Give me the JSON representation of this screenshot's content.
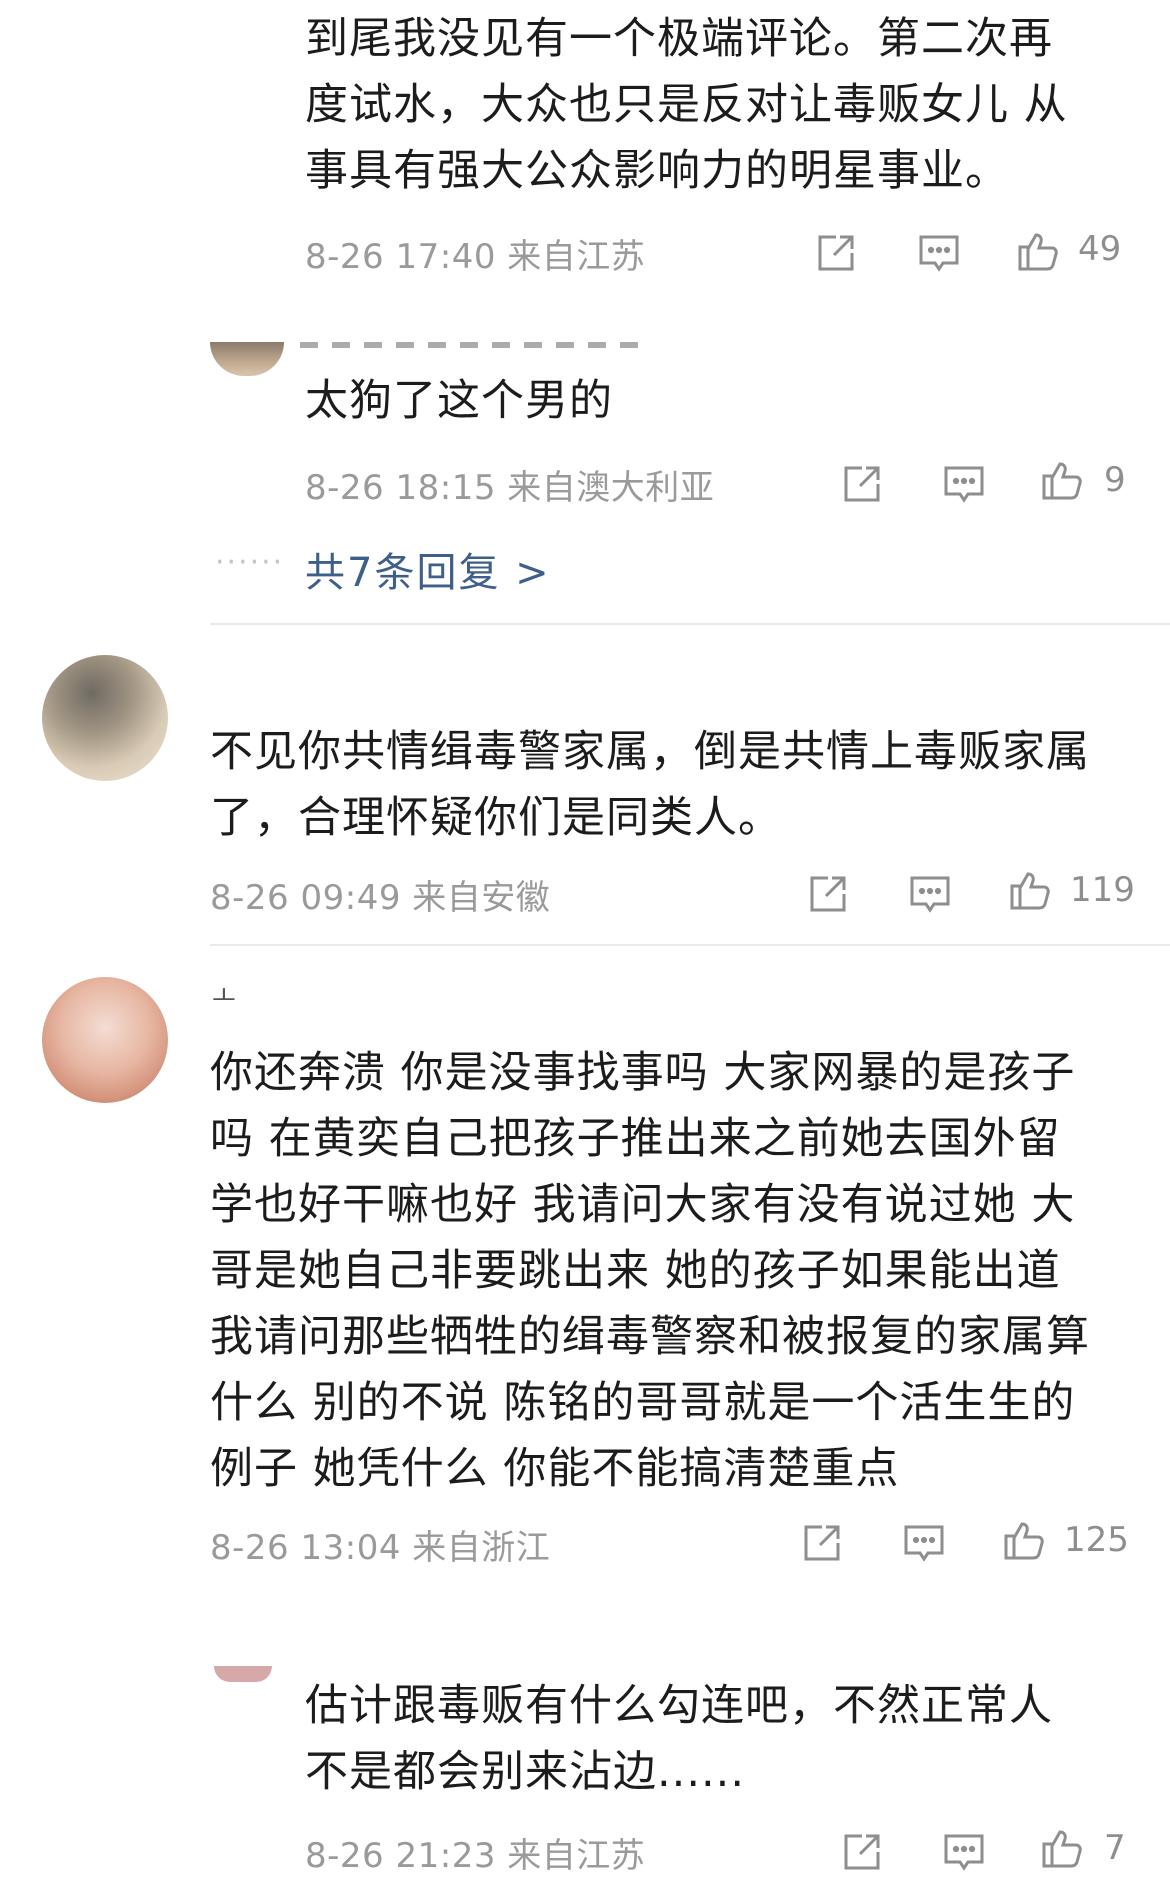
{
  "comments": [
    {
      "text": "到尾我没见有一个极端评论。第二次再\n度试水，大众也只是反对让毒贩女儿 从\n事具有强大公众影响力的明星事业。",
      "meta": "8-26 17:40  来自江苏",
      "likes": "49"
    },
    {
      "text": "太狗了这个男的",
      "meta": "8-26 18:15  来自澳大利亚",
      "likes": "9",
      "replies_link": "共7条回复 >",
      "replies_dots": "······"
    },
    {
      "text": "不见你共情缉毒警家属，倒是共情上毒贩家属\n了，合理怀疑你们是同类人。",
      "meta": "8-26 09:49  来自安徽",
      "likes": "119"
    },
    {
      "name_fragment": "ㅗ",
      "text": "你还奔溃 你是没事找事吗 大家网暴的是孩子\n吗 在黄奕自己把孩子推出来之前她去国外留\n学也好干嘛也好 我请问大家有没有说过她 大\n哥是她自己非要跳出来 她的孩子如果能出道\n我请问那些牺牲的缉毒警察和被报复的家属算\n什么 别的不说 陈铭的哥哥就是一个活生生的\n例子 她凭什么 你能不能搞清楚重点",
      "meta": "8-26 13:04  来自浙江",
      "likes": "125"
    },
    {
      "text": "估计跟毒贩有什么勾连吧，不然正常人\n不是都会别来沾边......",
      "meta": "8-26 21:23  来自江苏",
      "likes": "7"
    }
  ],
  "colors": {
    "text": "#1c1c1c",
    "meta": "#9a9a9a",
    "icon": "#8e8e8e",
    "link": "#3e5f8a",
    "divider": "#e9e9e9"
  },
  "icons": [
    "share-icon",
    "comment-icon",
    "like-icon"
  ]
}
